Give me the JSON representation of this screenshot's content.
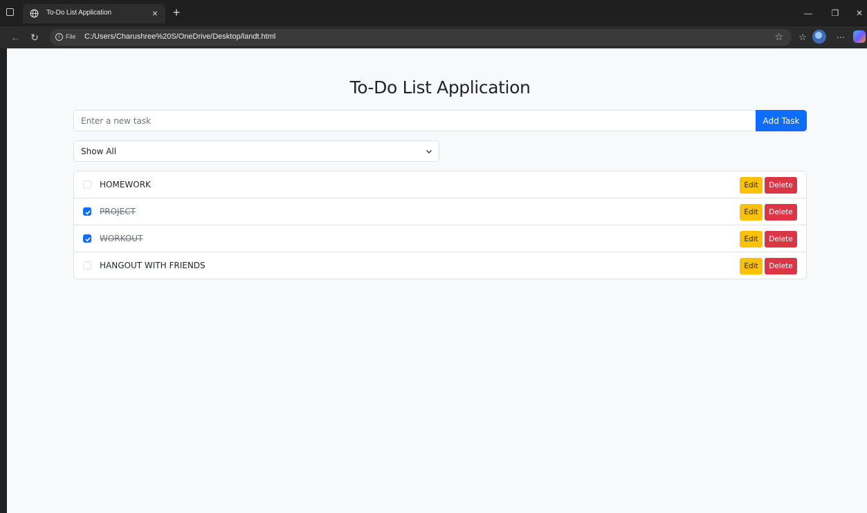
{
  "browser": {
    "tab_title": "To-Do List Application",
    "tab_close": "×",
    "new_tab": "+",
    "url_scheme": "File",
    "url": "C:/Users/Charushree%20S/OneDrive/Desktop/landt.html",
    "minimize": "—",
    "restore": "❐",
    "close": "✕",
    "more": "···"
  },
  "app": {
    "title": "To-Do List Application",
    "task_input": {
      "placeholder": "Enter a new task",
      "value": ""
    },
    "add_button": "Add Task",
    "filter": {
      "selected": "Show All"
    },
    "edit_label": "Edit",
    "delete_label": "Delete",
    "tasks": [
      {
        "text": "HOMEWORK",
        "done": false
      },
      {
        "text": "PROJECT",
        "done": true
      },
      {
        "text": "WORKOUT",
        "done": true
      },
      {
        "text": "HANGOUT WITH FRIENDS",
        "done": false
      }
    ]
  },
  "colors": {
    "primary": "#0d6efd",
    "warning": "#ffc107",
    "danger": "#dc3545",
    "page_bg": "#f8f9fa"
  }
}
